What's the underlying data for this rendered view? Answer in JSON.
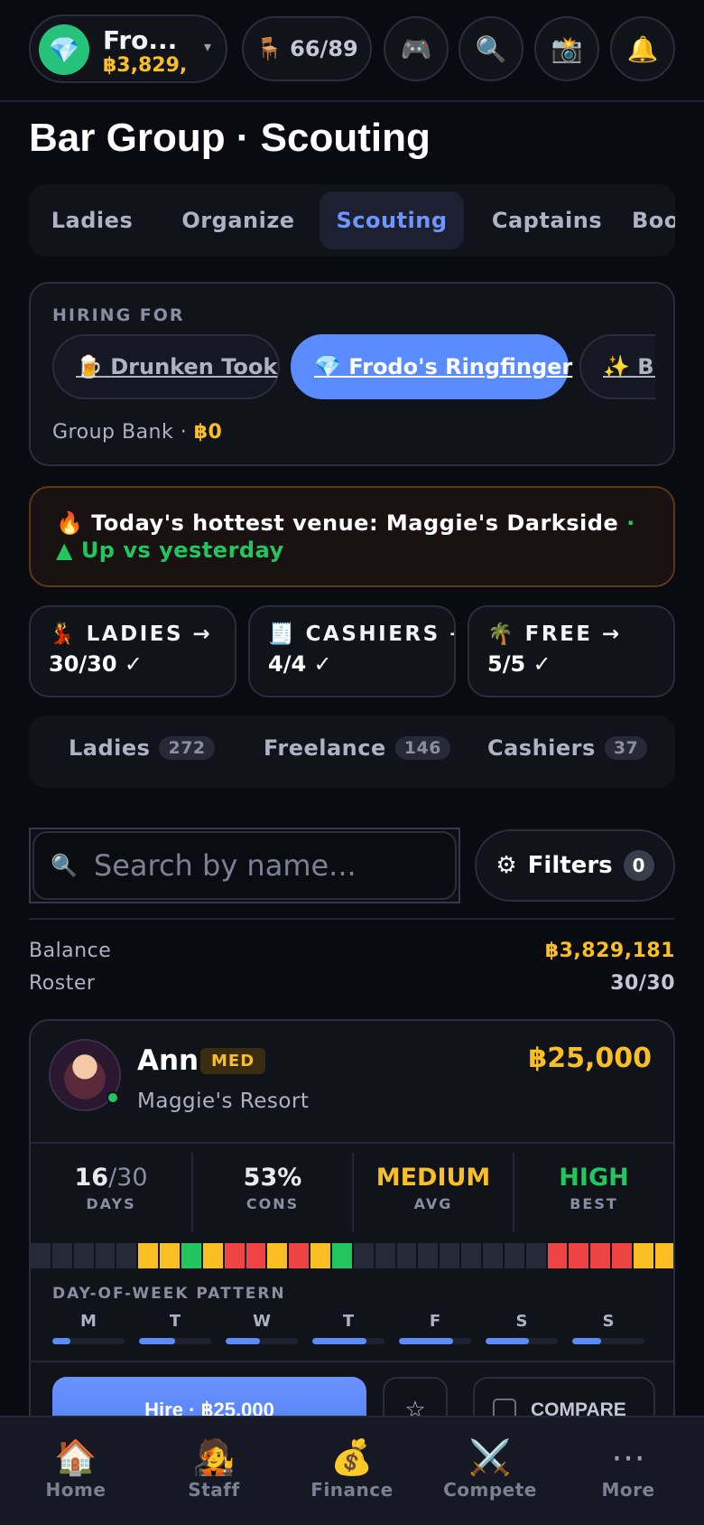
{
  "account": {
    "name": "Fro...",
    "balance": "฿3,829,",
    "gem_icon": "💎",
    "caret": "▾"
  },
  "seats": {
    "icon": "🪑",
    "value": "66/89"
  },
  "header_icons": {
    "game": "🎮",
    "search": "🔍",
    "camera": "📸",
    "bell": "🔔"
  },
  "page_title": "Bar Group · Scouting",
  "tabs": [
    {
      "label": "Ladies"
    },
    {
      "label": "Organize"
    },
    {
      "label": "Scouting",
      "active": true
    },
    {
      "label": "Captains"
    },
    {
      "label": "Boo"
    }
  ],
  "hiring": {
    "label": "HIRING FOR",
    "venues": [
      {
        "icon": "🍺",
        "name": "Drunken Took"
      },
      {
        "icon": "💎",
        "name": "Frodo's Ringfinger",
        "active": true
      },
      {
        "icon": "✨",
        "name": "Bi"
      }
    ],
    "bank_label": "Group Bank · ",
    "bank_value": "฿0"
  },
  "hottest": {
    "prefix": "🔥 Today's hottest venue: ",
    "venue": "Maggie's Darkside",
    "trend": " · ▲ Up vs yesterday"
  },
  "summary": [
    {
      "label": "💃 LADIES →",
      "value": "30/30 ✓"
    },
    {
      "label": "🧾 CASHIERS →",
      "value": "4/4 ✓"
    },
    {
      "label": "🌴 FREE →",
      "value": "5/5 ✓"
    }
  ],
  "categories": [
    {
      "label": "Ladies",
      "count": "272"
    },
    {
      "label": "Freelance",
      "count": "146"
    },
    {
      "label": "Cashiers",
      "count": "37"
    }
  ],
  "search": {
    "placeholder": "Search by name...",
    "icon": "🔍"
  },
  "filters": {
    "label": "Filters",
    "count": "0",
    "icon": "⚙"
  },
  "balance": {
    "label": "Balance",
    "value": "฿3,829,181"
  },
  "roster": {
    "label": "Roster",
    "value": "30/30"
  },
  "candidate": {
    "name": "Ann",
    "tag": "MED",
    "venue": "Maggie's Resort",
    "price": "฿25,000",
    "stats": [
      {
        "value": "16",
        "suffix": "/30",
        "label": "DAYS",
        "color": "#ffffff"
      },
      {
        "value": "53%",
        "suffix": "",
        "label": "CONS",
        "color": "#ffffff"
      },
      {
        "value": "MEDIUM",
        "suffix": "",
        "label": "AVG",
        "color": "#fbbf24"
      },
      {
        "value": "HIGH",
        "suffix": "",
        "label": "BEST",
        "color": "#22c55e"
      }
    ],
    "heatmap": [
      "e",
      "e",
      "e",
      "e",
      "e",
      "y",
      "y",
      "g",
      "y",
      "r",
      "r",
      "y",
      "r",
      "y",
      "g",
      "e",
      "e",
      "e",
      "e",
      "e",
      "e",
      "e",
      "e",
      "e",
      "r",
      "r",
      "r",
      "r",
      "y",
      "y"
    ],
    "heat_colors": {
      "e": "#262a38",
      "y": "#fbbf24",
      "g": "#22c55e",
      "r": "#ef4444"
    },
    "dow_label": "DAY-OF-WEEK PATTERN",
    "dow": [
      {
        "day": "M",
        "level": 0.25
      },
      {
        "day": "T",
        "level": 0.5
      },
      {
        "day": "W",
        "level": 0.48
      },
      {
        "day": "T",
        "level": 0.75
      },
      {
        "day": "F",
        "level": 0.75
      },
      {
        "day": "S",
        "level": 0.6
      },
      {
        "day": "S",
        "level": 0.4
      }
    ],
    "hire_label": "Hire · ฿25,000",
    "star_icon": "☆",
    "compare_label": "COMPARE"
  },
  "bottom_nav": [
    {
      "icon": "🏠",
      "label": "Home"
    },
    {
      "icon": "🧑‍🎤",
      "label": "Staff"
    },
    {
      "icon": "💰",
      "label": "Finance"
    },
    {
      "icon": "⚔️",
      "label": "Compete"
    },
    {
      "icon": "⋯",
      "label": "More"
    }
  ]
}
